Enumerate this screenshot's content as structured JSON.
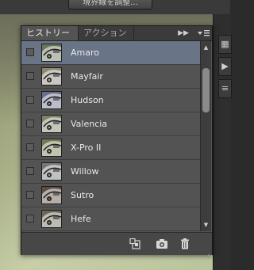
{
  "background": {
    "toolbar_button_label": "境界線を調整..."
  },
  "panel": {
    "tabs": [
      {
        "label": "ヒストリー",
        "active": true
      },
      {
        "label": "アクション",
        "active": false
      }
    ],
    "collapse_icon": "double-chevron-right-icon",
    "menu_icon": "panel-menu-icon",
    "items": [
      {
        "label": "Amaro",
        "selected": true,
        "tint": "#8c9b7a"
      },
      {
        "label": "Mayfair",
        "selected": false,
        "tint": "#b9b39a"
      },
      {
        "label": "Hudson",
        "selected": false,
        "tint": "#8c95b7"
      },
      {
        "label": "Valencia",
        "selected": false,
        "tint": "#a3b08a"
      },
      {
        "label": "X-Pro II",
        "selected": false,
        "tint": "#98a66f"
      },
      {
        "label": "Willow",
        "selected": false,
        "tint": "#9c9c9c"
      },
      {
        "label": "Sutro",
        "selected": false,
        "tint": "#7e6658"
      },
      {
        "label": "Hefe",
        "selected": false,
        "tint": "#8f8a70"
      }
    ],
    "footer_icons": [
      "new-document-from-state-icon",
      "snapshot-camera-icon",
      "trash-icon"
    ]
  },
  "colors": {
    "selection": "#6a7487",
    "panel_bg": "#535353"
  }
}
